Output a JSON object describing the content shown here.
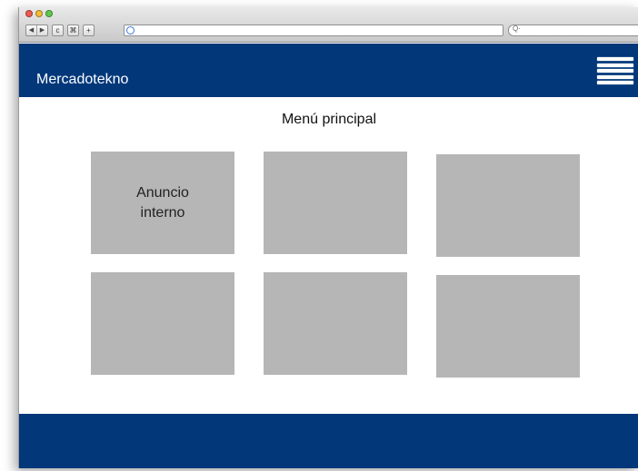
{
  "browser": {
    "nav_back": "◀",
    "nav_forward": "▶",
    "reload": "c",
    "bookmarks": "⌘",
    "new_tab": "+",
    "search_icon": "Q·"
  },
  "header": {
    "brand": "Mercadotekno",
    "menu_icon": "hamburger-icon"
  },
  "main": {
    "title": "Menú principal",
    "tiles": [
      {
        "label": "Anuncio interno"
      },
      {
        "label": ""
      },
      {
        "label": ""
      },
      {
        "label": ""
      },
      {
        "label": ""
      },
      {
        "label": ""
      }
    ]
  },
  "colors": {
    "brand_blue": "#02387a",
    "tile_gray": "#b6b6b6"
  }
}
